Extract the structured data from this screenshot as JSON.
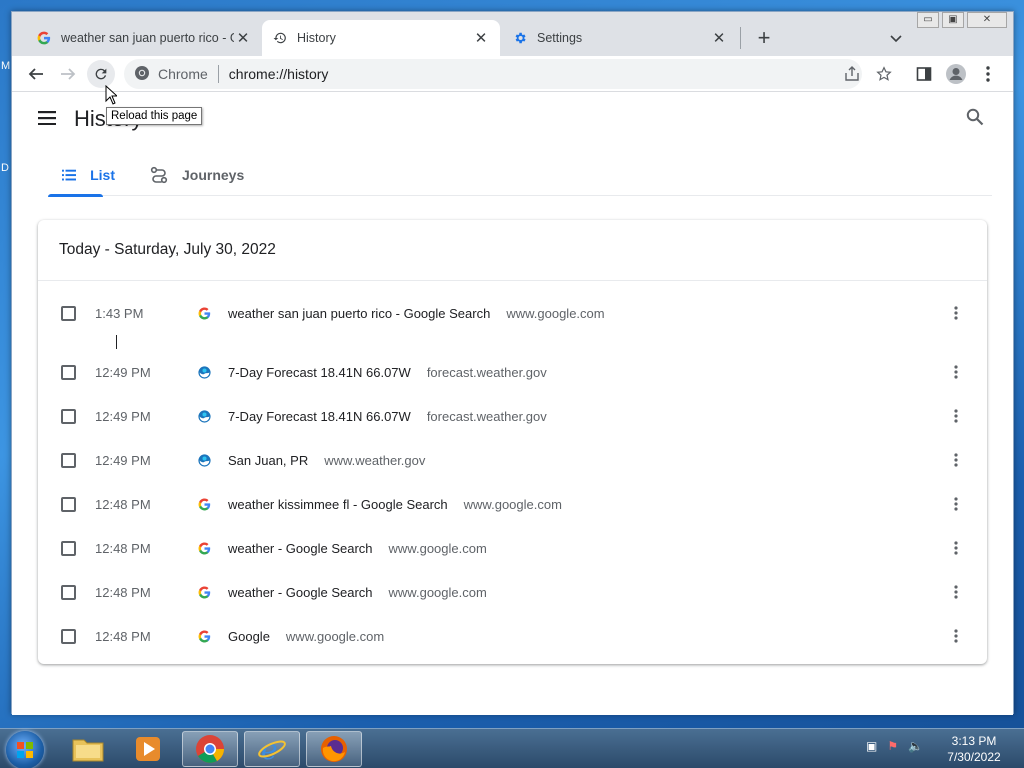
{
  "desktop": {
    "left_text": "M\n\nD"
  },
  "browser": {
    "tabs": [
      {
        "title": "weather san juan puerto rico - Go",
        "close": "✕",
        "active": false
      },
      {
        "title": "History",
        "close": "✕",
        "active": true
      },
      {
        "title": "Settings",
        "close": "✕",
        "active": false
      }
    ],
    "new_tab": "+",
    "window_controls": {
      "minimize": "▭",
      "maximize": "▣",
      "close": "✕"
    },
    "omnibox": {
      "chip": "Chrome",
      "url_prefix": "chrome://",
      "url_path": "history"
    },
    "tooltip": "Reload this page"
  },
  "history": {
    "title": "History",
    "tabs": [
      {
        "label": "List"
      },
      {
        "label": "Journeys"
      }
    ],
    "group_header": "Today - Saturday, July 30, 2022",
    "rows": [
      {
        "time": "1:43 PM",
        "icon": "google",
        "title": "weather san juan puerto rico - Google Search",
        "domain": "www.google.com"
      },
      {
        "time": "12:49 PM",
        "icon": "noaa",
        "title": "7-Day Forecast 18.41N 66.07W",
        "domain": "forecast.weather.gov"
      },
      {
        "time": "12:49 PM",
        "icon": "noaa",
        "title": "7-Day Forecast 18.41N 66.07W",
        "domain": "forecast.weather.gov"
      },
      {
        "time": "12:49 PM",
        "icon": "noaa",
        "title": "San Juan, PR",
        "domain": "www.weather.gov"
      },
      {
        "time": "12:48 PM",
        "icon": "google",
        "title": "weather kissimmee fl - Google Search",
        "domain": "www.google.com"
      },
      {
        "time": "12:48 PM",
        "icon": "google",
        "title": "weather - Google Search",
        "domain": "www.google.com"
      },
      {
        "time": "12:48 PM",
        "icon": "google",
        "title": "weather - Google Search",
        "domain": "www.google.com"
      },
      {
        "time": "12:48 PM",
        "icon": "google",
        "title": "Google",
        "domain": "www.google.com"
      }
    ]
  },
  "taskbar": {
    "clock_time": "3:13 PM",
    "clock_date": "7/30/2022",
    "apps": [
      "explorer",
      "media-player",
      "chrome",
      "internet-explorer",
      "firefox"
    ]
  },
  "colors": {
    "accent": "#1a73e8",
    "tabstrip": "#dee1e6",
    "omnibox": "#f1f3f4"
  }
}
